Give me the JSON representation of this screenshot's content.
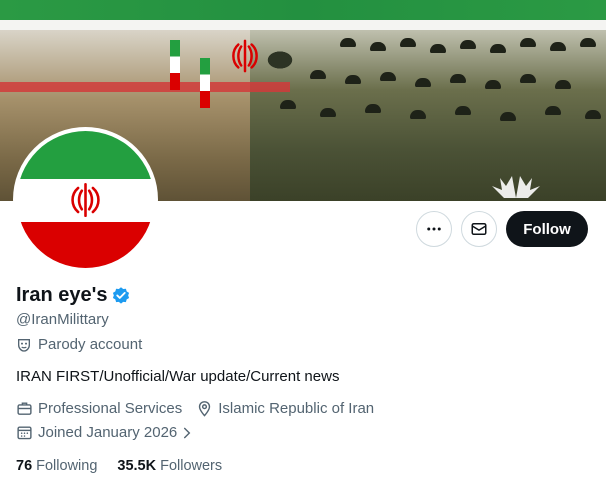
{
  "profile": {
    "display_name": "Iran eye's",
    "handle": "@IranMilittary",
    "label": "Parody account",
    "bio": "IRAN FIRST/Unofficial/War update/Current news",
    "category": "Professional Services",
    "location": "Islamic Republic of Iran",
    "joined": "Joined January 2026"
  },
  "actions": {
    "more_icon": "more-dots-icon",
    "message_icon": "envelope-icon",
    "follow_label": "Follow"
  },
  "stats": {
    "following_count": "76",
    "following_label": "Following",
    "followers_count": "35.5K",
    "followers_label": "Followers"
  },
  "colors": {
    "accent": "#0f1419",
    "verified": "#1d9bf0",
    "secondary_text": "#536471",
    "flag_green": "#239f40",
    "flag_red": "#da0000"
  }
}
